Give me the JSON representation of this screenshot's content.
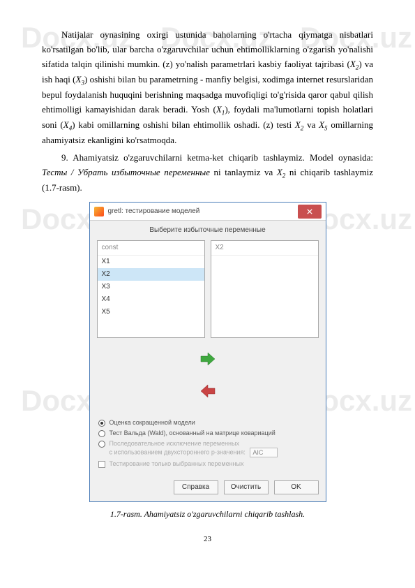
{
  "watermark": "Docx.uz",
  "paragraphs": {
    "p1_a": "Natijalar oynasining oxirgi ustunida baholarning o'rtacha qiymatga nisbatlari ko'rsatilgan bo'lib, ular barcha o'zgaruvchilar uchun ehtimolliklarning o'zgarish yo'nalishi sifatida talqin qilinishi mumkin. (z) yo'nalish parametrlari kasbiy faoliyat tajribasi (",
    "p1_b": ") va ish haqi (",
    "p1_c": ") oshishi bilan bu parametrning - manfiy belgisi, xodimga internet resurslaridan bepul foydalanish huquqini berishning maqsadga muvofiqligi to'g'risida qaror qabul qilish ehtimolligi kamayishidan darak beradi. Yosh (",
    "p1_d": "), foydali ma'lumotlarni topish holatlari soni (",
    "p1_e": ") kabi omillarning oshishi bilan ehtimollik oshadi. (z) testi ",
    "p1_f": " va ",
    "p1_g": " omillarning ahamiyatsiz ekanligini ko'rsatmoqda.",
    "p2_a": "9. Ahamiyatsiz o'zgaruvchilarni ketma-ket chiqarib tashlaymiz. Model oynasida: ",
    "p2_b": "Тесты / Убрать избыточные переменные",
    "p2_c": " ni tanlaymiz va ",
    "p2_d": " ni chiqarib tashlaymiz (1.7-rasm)."
  },
  "vars": {
    "x1": "X",
    "x1sub": "1",
    "x2": "X",
    "x2sub": "2",
    "x3": "X",
    "x3sub": "3",
    "x4": "X",
    "x4sub": "4",
    "x5": "X",
    "x5sub": "5"
  },
  "dialog": {
    "title": "gretl: тестирование моделей",
    "subtitle": "Выберите избыточные переменные",
    "left_header": "const",
    "left_items": [
      "X1",
      "X2",
      "X3",
      "X4",
      "X5"
    ],
    "selected_index": 1,
    "right_header": "X2",
    "options": {
      "opt1": "Оценка сокращенной модели",
      "opt2": "Тест Вальда (Wald), основанный на матрице ковариаций",
      "opt3_line1": "Последовательное исключение переменных",
      "opt3_line2": "с использованием двухстороннего p-значения:",
      "opt4": "Тестирование только выбранных переменных",
      "aic_label": "AIC"
    },
    "buttons": {
      "help": "Справка",
      "clear": "Очистить",
      "ok": "OK"
    }
  },
  "caption": "1.7-rasm. Ahamiyatsiz o'zgaruvchilarni chiqarib tashlash.",
  "page_number": "23"
}
